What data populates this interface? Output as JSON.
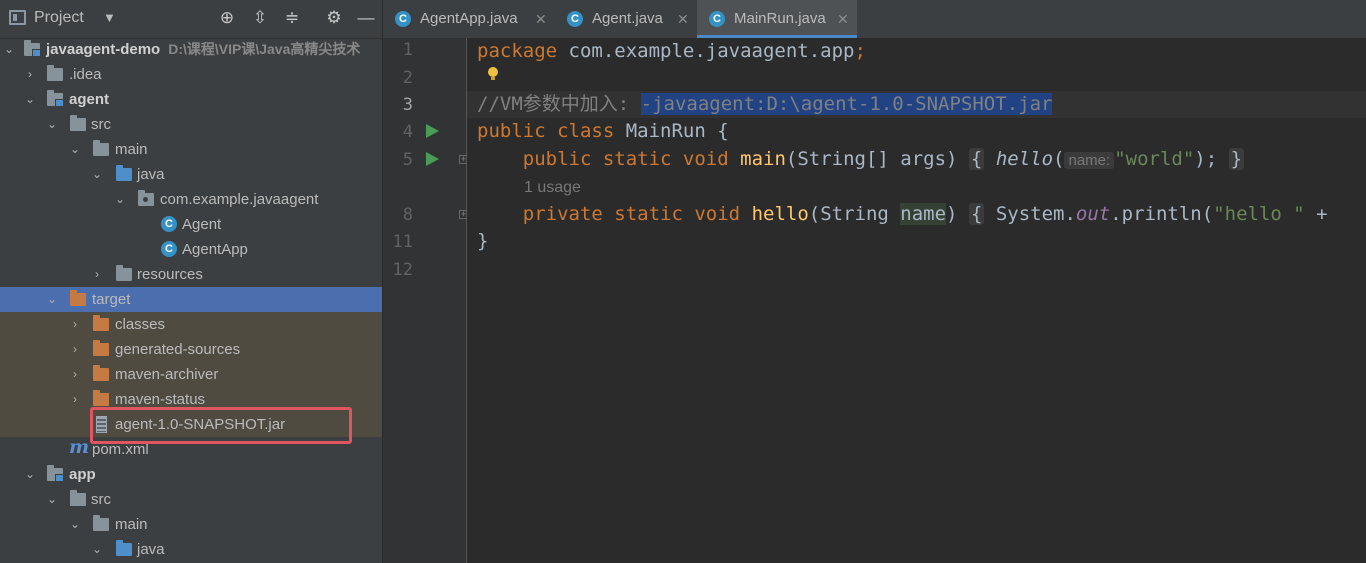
{
  "project_panel": {
    "title": "Project",
    "icons": [
      "project-view-icon",
      "chevron-down-icon",
      "locate-icon",
      "expand-all-icon",
      "collapse-all-icon",
      "gear-icon",
      "minimize-icon"
    ],
    "tree": [
      {
        "label": "javaagent-demo",
        "path": "D:\\课程\\VIP课\\Java高精尖技术",
        "bold": true
      },
      {
        "label": ".idea"
      },
      {
        "label": "agent",
        "bold": true
      },
      {
        "label": "src"
      },
      {
        "label": "main"
      },
      {
        "label": "java"
      },
      {
        "label": "com.example.javaagent"
      },
      {
        "label": "Agent"
      },
      {
        "label": "AgentApp"
      },
      {
        "label": "resources"
      },
      {
        "label": "target"
      },
      {
        "label": "classes"
      },
      {
        "label": "generated-sources"
      },
      {
        "label": "maven-archiver"
      },
      {
        "label": "maven-status"
      },
      {
        "label": "agent-1.0-SNAPSHOT.jar"
      },
      {
        "label": "pom.xml"
      },
      {
        "label": "app",
        "bold": true
      },
      {
        "label": "src"
      },
      {
        "label": "main"
      },
      {
        "label": "java"
      }
    ]
  },
  "tabs": [
    {
      "label": "AgentApp.java",
      "active": false
    },
    {
      "label": "Agent.java",
      "active": false
    },
    {
      "label": "MainRun.java",
      "active": true
    }
  ],
  "editor": {
    "line_numbers": [
      "1",
      "2",
      "3",
      "4",
      "5",
      "8",
      "11",
      "12"
    ],
    "line1": {
      "kw": "package",
      "rest": " com.example.javaagent.app",
      "semi": ";"
    },
    "line3": {
      "comment": "//VM参数中加入: ",
      "selected": "-javaagent:D:\\agent-1.0-SNAPSHOT.jar"
    },
    "line4": {
      "kw": "public class",
      "rest": " MainRun {"
    },
    "line5": {
      "kw": "    public static void",
      "fn": "main",
      "args": "(String[] args) ",
      "brace_open": "{",
      "call": "hello",
      "paren": "(",
      "hint": "name:",
      "str": "\"world\"",
      "tail": ");",
      "brace_close": "}"
    },
    "usage": "1 usage",
    "line8": {
      "kw": "    private static void",
      "fn": "hello",
      "args": "(String ",
      "param": "name",
      "close": ") ",
      "brace_open": "{",
      "sys": " System.",
      "out": "out",
      "println": ".println(",
      "str": "\"hello \"",
      "plus": " +"
    },
    "line11": "}"
  }
}
